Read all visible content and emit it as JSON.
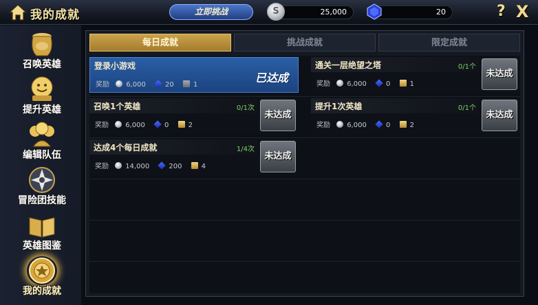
{
  "header": {
    "title": "我的成就",
    "challenge_label": "立即挑战",
    "silver_symbol": "S",
    "silver": "25,000",
    "gems": "20",
    "help": "?",
    "close": "X"
  },
  "sidebar": {
    "items": [
      {
        "label": "召唤英雄",
        "icon": "jar-icon",
        "active": false
      },
      {
        "label": "提升英雄",
        "icon": "level-up-icon",
        "active": false
      },
      {
        "label": "编辑队伍",
        "icon": "team-icon",
        "active": false
      },
      {
        "label": "冒险团技能",
        "icon": "compass-star-icon",
        "active": false
      },
      {
        "label": "英雄图鉴",
        "icon": "book-icon",
        "active": false
      },
      {
        "label": "我的成就",
        "icon": "medal-icon",
        "active": true
      }
    ]
  },
  "tabs": [
    {
      "label": "每日成就",
      "active": true
    },
    {
      "label": "挑战成就",
      "active": false
    },
    {
      "label": "限定成就",
      "active": false
    }
  ],
  "achievements": [
    {
      "title": "登录小游戏",
      "progress": "",
      "reward_label": "奖励",
      "silver": "6,000",
      "gems": "20",
      "exp": "1",
      "status": "已达成",
      "done": true
    },
    {
      "title": "通关一层绝望之塔",
      "progress": "0/1个",
      "reward_label": "奖励",
      "silver": "6,000",
      "gems": "0",
      "exp": "1",
      "status": "未达成",
      "done": false
    },
    {
      "title": "召唤1个英雄",
      "progress": "0/1次",
      "reward_label": "奖励",
      "silver": "6,000",
      "gems": "0",
      "exp": "2",
      "status": "未达成",
      "done": false
    },
    {
      "title": "提升1次英雄",
      "progress": "0/1个",
      "reward_label": "奖励",
      "silver": "6,000",
      "gems": "0",
      "exp": "2",
      "status": "未达成",
      "done": false
    },
    {
      "title": "达成4个每日成就",
      "progress": "1/4次",
      "reward_label": "奖励",
      "silver": "14,000",
      "gems": "200",
      "exp": "4",
      "status": "未达成",
      "done": false
    }
  ],
  "colors": {
    "accent_gold": "#caa24c",
    "done_blue": "#2a5fa6",
    "progress_green": "#7fd36b"
  }
}
